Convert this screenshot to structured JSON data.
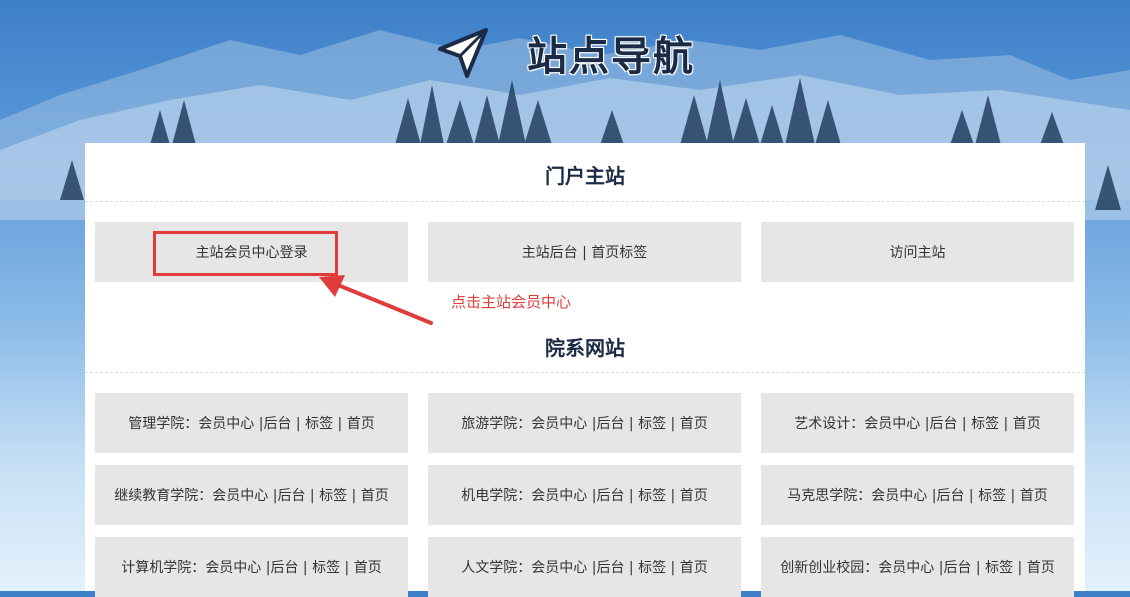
{
  "header": {
    "title": "站点导航",
    "icon": "paper-plane-icon"
  },
  "colors": {
    "title": "#1b2a45",
    "tile_bg": "#e6e6e6",
    "annotation": "#e03c3c",
    "sky_top": "#3d7fc8",
    "sky_bottom": "#e3f1fc"
  },
  "portal": {
    "title": "门户主站",
    "links": [
      "主站会员中心登录",
      "主站后台 | 首页标签",
      "访问主站"
    ]
  },
  "annotation": {
    "hint": "点击主站会员中心"
  },
  "departments": {
    "title": "院系网站",
    "links": [
      "管理学院：会员中心 |后台 | 标签 | 首页",
      "旅游学院：会员中心 |后台 | 标签 | 首页",
      "艺术设计：会员中心 |后台 | 标签 | 首页",
      "继续教育学院：会员中心 |后台 | 标签 | 首页",
      "机电学院：会员中心 |后台 | 标签 | 首页",
      "马克思学院：会员中心 |后台 | 标签 | 首页",
      "计算机学院：会员中心 |后台 | 标签 | 首页",
      "人文学院：会员中心 |后台 | 标签 | 首页",
      "创新创业校园：会员中心 |后台 | 标签 | 首页"
    ]
  }
}
